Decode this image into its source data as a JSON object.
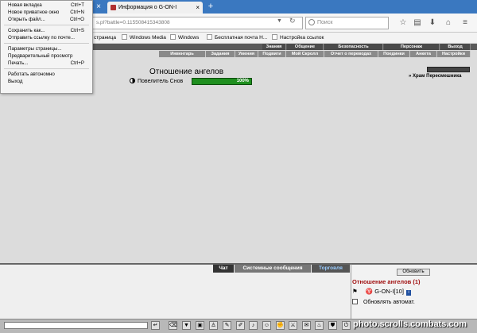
{
  "browser": {
    "tab_title": "Информация о G-ON-I",
    "url_fragment": "s.pl?battle=0.115508415343808",
    "search_placeholder": "Поиск",
    "new_tab_symbol": "+",
    "close_symbol": "×"
  },
  "bookmarks": [
    {
      "label": "страница"
    },
    {
      "label": "Windows Media"
    },
    {
      "label": "Windows"
    },
    {
      "label": "Бесплатная почта H..."
    },
    {
      "label": "Настройка ссылок"
    }
  ],
  "file_menu": {
    "items": [
      {
        "label": "Новая вкладка",
        "shortcut": "Ctrl+T"
      },
      {
        "label": "Новое приватное окно",
        "shortcut": "Ctrl+N"
      },
      {
        "label": "Открыть файл...",
        "shortcut": "Ctrl+O"
      },
      {
        "label": "Сохранить как...",
        "shortcut": "Ctrl+S"
      },
      {
        "label": "Отправить ссылку по почте...",
        "shortcut": ""
      },
      {
        "label": "Параметры страницы...",
        "shortcut": ""
      },
      {
        "label": "Предварительный просмотр",
        "shortcut": ""
      },
      {
        "label": "Печать...",
        "shortcut": "Ctrl+P"
      },
      {
        "label": "Работать автономно",
        "shortcut": ""
      },
      {
        "label": "Выход",
        "shortcut": ""
      }
    ]
  },
  "game_nav": {
    "top": [
      "Знания",
      "Общение",
      "Безопасность",
      "Персонаж",
      "Выход"
    ],
    "sub": [
      "Инвентарь",
      "Задания",
      "Умения",
      "Подвиги",
      "Мой Скролл",
      "Отчет о переводах",
      "Поединки",
      "Анкета",
      "Настройки"
    ]
  },
  "page": {
    "title": "Отношение ангелов",
    "angel_name": "Повелитель Снов",
    "progress_label": "100%",
    "progress_value": 1.0,
    "temple_link": "Храм Пересмешника"
  },
  "chat": {
    "tabs": [
      "Чат",
      "Системные сообщения",
      "Торговля"
    ]
  },
  "side": {
    "refresh_label": "Обновить",
    "title": "Отношение ангелов (1)",
    "user": "G-ON-I[10]",
    "info_badge": "i",
    "auto_refresh_label": "Обновлять автомат."
  },
  "watermark": "photo.scrolls.combats.com"
}
